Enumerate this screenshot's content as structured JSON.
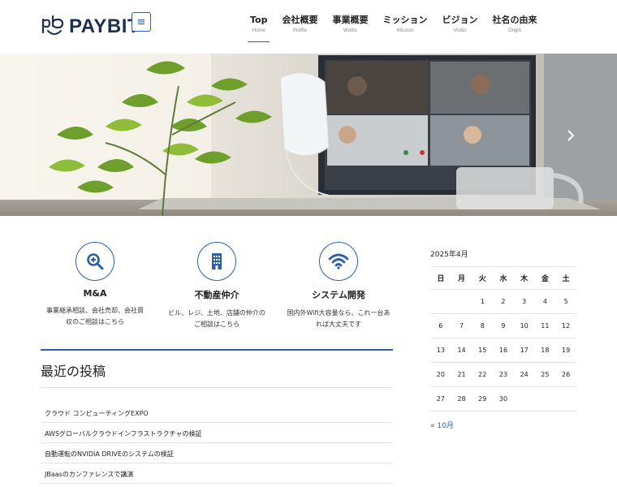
{
  "brand": {
    "name": "PAYBIT",
    "accent": "#2b5fa8",
    "navy": "#1f2f4f"
  },
  "nav": [
    {
      "jp": "Top",
      "en": "Home"
    },
    {
      "jp": "会社概要",
      "en": "Profile"
    },
    {
      "jp": "事業概要",
      "en": "Works"
    },
    {
      "jp": "ミッション",
      "en": "Mission"
    },
    {
      "jp": "ビジョン",
      "en": "Vision"
    },
    {
      "jp": "社名の由来",
      "en": "Origin"
    }
  ],
  "menu_icon": "hamburger-icon",
  "services": [
    {
      "icon": "magnifier-icon",
      "title": "M&A",
      "desc1": "事業継承相談、会社売却、会社買",
      "desc2": "収のご相談はこちら"
    },
    {
      "icon": "building-icon",
      "title": "不動産仲介",
      "desc1": "ビル、レジ、土地、店舗の仲介の",
      "desc2": "ご相談はこちら"
    },
    {
      "icon": "wifi-icon",
      "title": "システム開発",
      "desc1": "国内外Wifi大容量なら、これ一台あ",
      "desc2": "れば大丈夫です"
    }
  ],
  "recent_posts": {
    "heading": "最近の投稿",
    "items": [
      "クラウド コンピューティングEXPO",
      "AWSグローバルクラウドインフラストラクチャの検証",
      "自動運転のNVIDIA DRIVEのシステムの検証",
      "JBaasのカンファレンスで講演"
    ]
  },
  "calendar": {
    "caption": "2025年4月",
    "weekdays": [
      "日",
      "月",
      "火",
      "水",
      "木",
      "金",
      "土"
    ],
    "weeks": [
      [
        "",
        "",
        "1",
        "2",
        "3",
        "4",
        "5"
      ],
      [
        "6",
        "7",
        "8",
        "9",
        "10",
        "11",
        "12"
      ],
      [
        "13",
        "14",
        "15",
        "16",
        "17",
        "18",
        "19"
      ],
      [
        "20",
        "21",
        "22",
        "23",
        "24",
        "25",
        "26"
      ],
      [
        "27",
        "28",
        "29",
        "30",
        "",
        "",
        ""
      ]
    ],
    "prev_link": "« 10月"
  }
}
